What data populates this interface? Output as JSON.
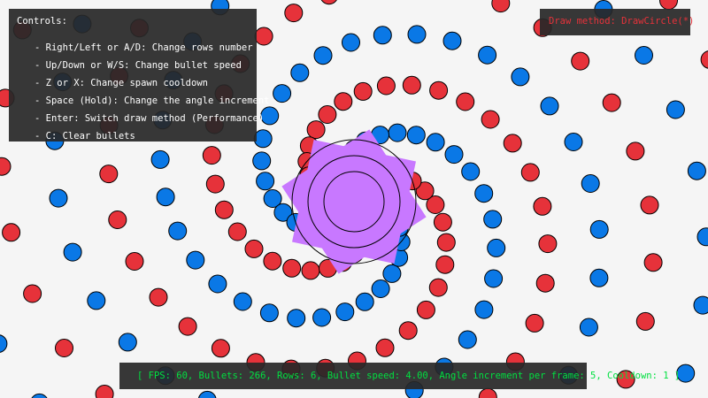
{
  "controls": {
    "title": "Controls:",
    "items": [
      "- Right/Left or A/D: Change rows number",
      "- Up/Down or W/S: Change bullet speed",
      "- Z or X: Change spawn cooldown",
      "- Space (Hold): Change the angle increment",
      "- Enter: Switch draw method (Performance)",
      "- C: Clear bullets"
    ]
  },
  "draw_method": "Draw method: DrawCircle(*)",
  "stats": "[ FPS: 60, Bullets: 266, Rows: 6, Bullet speed: 4.00, Angle increment per frame: 5, Cooldown: 1 ]",
  "colors": {
    "background": "#f5f5f5",
    "bullet_red": "#e6323a",
    "bullet_blue": "#0a78e6",
    "emitter_purple": "#c878ff",
    "panel": "#282828",
    "stats_text": "#00e040",
    "method_text": "#e6323a"
  }
}
